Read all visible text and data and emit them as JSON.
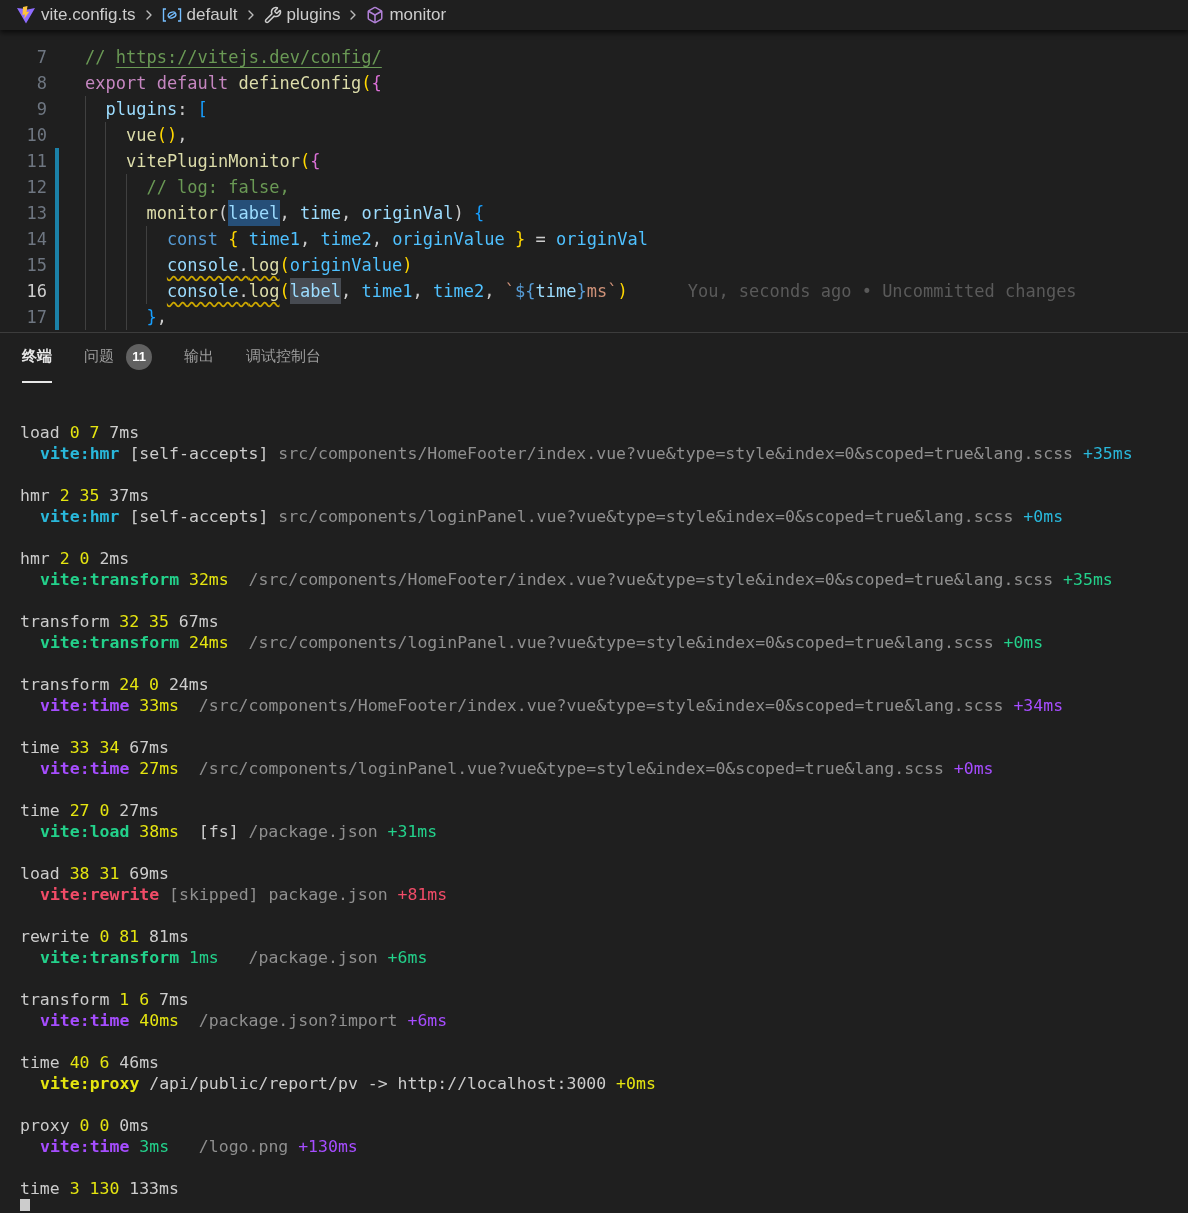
{
  "breadcrumb": [
    {
      "kind": "vite",
      "label": "vite.config.ts"
    },
    {
      "kind": "module",
      "label": "default"
    },
    {
      "kind": "property",
      "label": "plugins"
    },
    {
      "kind": "method",
      "label": "monitor"
    }
  ],
  "editor": {
    "lines": [
      {
        "number": "7",
        "current": false,
        "modified": false,
        "tokens": [
          {
            "kind": "comment",
            "text": "// "
          },
          {
            "kind": "link",
            "text": "https://vitejs.dev/config/"
          }
        ]
      },
      {
        "number": "8",
        "current": false,
        "modified": false,
        "tokens": [
          {
            "kind": "keyword",
            "text": "export default "
          },
          {
            "kind": "func",
            "text": "defineConfig"
          },
          {
            "kind": "bracket1",
            "text": "("
          },
          {
            "kind": "bracket2",
            "text": "{"
          }
        ],
        "children": [
          {
            "number": "9",
            "current": false,
            "modified": false,
            "tokens": [
              {
                "kind": "var",
                "text": "plugins"
              },
              {
                "kind": "plain",
                "text": ": "
              },
              {
                "kind": "bracket3",
                "text": "["
              }
            ],
            "children": [
              {
                "number": "10",
                "current": false,
                "modified": false,
                "tokens": [
                  {
                    "kind": "func",
                    "text": "vue"
                  },
                  {
                    "kind": "bracket1",
                    "text": "()"
                  },
                  {
                    "kind": "plain",
                    "text": ","
                  }
                ]
              },
              {
                "number": "11",
                "current": false,
                "modified": true,
                "tokens": [
                  {
                    "kind": "func",
                    "text": "vitePluginMonitor"
                  },
                  {
                    "kind": "bracket1",
                    "text": "("
                  },
                  {
                    "kind": "bracket2",
                    "text": "{"
                  }
                ],
                "children": [
                  {
                    "number": "12",
                    "current": false,
                    "modified": true,
                    "tokens": [
                      {
                        "kind": "comment",
                        "text": "// log: false,"
                      }
                    ]
                  },
                  {
                    "number": "13",
                    "current": false,
                    "modified": true,
                    "tokens": [
                      {
                        "kind": "func",
                        "text": "monitor"
                      },
                      {
                        "kind": "plain",
                        "text": "("
                      },
                      {
                        "kind": "var-selected",
                        "text": "label"
                      },
                      {
                        "kind": "plain",
                        "text": ", "
                      },
                      {
                        "kind": "var",
                        "text": "time"
                      },
                      {
                        "kind": "plain",
                        "text": ", "
                      },
                      {
                        "kind": "var",
                        "text": "originVal"
                      },
                      {
                        "kind": "plain",
                        "text": ") "
                      },
                      {
                        "kind": "bracket3",
                        "text": "{"
                      }
                    ],
                    "children": [
                      {
                        "number": "14",
                        "current": false,
                        "modified": true,
                        "tokens": [
                          {
                            "kind": "storage",
                            "text": "const "
                          },
                          {
                            "kind": "bracket1",
                            "text": "{ "
                          },
                          {
                            "kind": "const",
                            "text": "time1"
                          },
                          {
                            "kind": "plain",
                            "text": ", "
                          },
                          {
                            "kind": "const",
                            "text": "time2"
                          },
                          {
                            "kind": "plain",
                            "text": ", "
                          },
                          {
                            "kind": "const",
                            "text": "originValue "
                          },
                          {
                            "kind": "bracket1",
                            "text": "} "
                          },
                          {
                            "kind": "plain",
                            "text": "= "
                          },
                          {
                            "kind": "const",
                            "text": "originVal"
                          }
                        ]
                      },
                      {
                        "number": "15",
                        "current": false,
                        "modified": true,
                        "tokens": [
                          {
                            "kind": "var-warn",
                            "text": "console"
                          },
                          {
                            "kind": "plain-warn",
                            "text": "."
                          },
                          {
                            "kind": "func-warn",
                            "text": "log"
                          },
                          {
                            "kind": "bracket1",
                            "text": "("
                          },
                          {
                            "kind": "const",
                            "text": "originValue"
                          },
                          {
                            "kind": "bracket1",
                            "text": ")"
                          }
                        ]
                      },
                      {
                        "number": "16",
                        "current": true,
                        "modified": true,
                        "blame": "You, seconds ago • Uncommitted changes",
                        "tokens": [
                          {
                            "kind": "var-warn",
                            "text": "console"
                          },
                          {
                            "kind": "plain-warn",
                            "text": "."
                          },
                          {
                            "kind": "func-warn",
                            "text": "log"
                          },
                          {
                            "kind": "bracket1",
                            "text": "("
                          },
                          {
                            "kind": "var-match",
                            "text": "label"
                          },
                          {
                            "kind": "plain",
                            "text": ", "
                          },
                          {
                            "kind": "const",
                            "text": "time1"
                          },
                          {
                            "kind": "plain",
                            "text": ", "
                          },
                          {
                            "kind": "const",
                            "text": "time2"
                          },
                          {
                            "kind": "plain",
                            "text": ", "
                          },
                          {
                            "kind": "string",
                            "text": "`"
                          },
                          {
                            "kind": "storage",
                            "text": "${"
                          },
                          {
                            "kind": "var",
                            "text": "time"
                          },
                          {
                            "kind": "storage",
                            "text": "}"
                          },
                          {
                            "kind": "string",
                            "text": "ms`"
                          },
                          {
                            "kind": "bracket1",
                            "text": ")"
                          }
                        ]
                      }
                    ]
                  },
                  {
                    "number": "17",
                    "current": false,
                    "modified": true,
                    "tokens": [
                      {
                        "kind": "bracket3",
                        "text": "}"
                      },
                      {
                        "kind": "plain",
                        "text": ","
                      }
                    ]
                  }
                ]
              }
            ]
          }
        ]
      }
    ]
  },
  "panel": {
    "tabs": [
      {
        "label": "终端",
        "selected": true
      },
      {
        "label": "问题",
        "selected": false,
        "badge": "11"
      },
      {
        "label": "输出",
        "selected": false
      },
      {
        "label": "调试控制台",
        "selected": false
      }
    ]
  },
  "terminal": {
    "entries": [
      {
        "head": [
          {
            "kind": "word",
            "text": "load"
          },
          {
            "kind": "num",
            "text": "0 7"
          },
          {
            "kind": "word",
            "text": "7ms"
          }
        ],
        "detail": [
          {
            "kind": "cyan-tag",
            "text": "vite:hmr"
          },
          {
            "kind": "word",
            "text": "[self-accepts]"
          },
          {
            "kind": "dim",
            "text": "src/components/HomeFooter/index.vue?vue&type=style&index=0&scoped=true&lang.scss"
          },
          {
            "kind": "cyan",
            "text": "+35ms"
          }
        ]
      },
      {
        "head": [
          {
            "kind": "word",
            "text": "hmr"
          },
          {
            "kind": "num",
            "text": "2 35"
          },
          {
            "kind": "word",
            "text": "37ms"
          }
        ],
        "detail": [
          {
            "kind": "cyan-tag",
            "text": "vite:hmr"
          },
          {
            "kind": "word",
            "text": "[self-accepts]"
          },
          {
            "kind": "dim",
            "text": "src/components/loginPanel.vue?vue&type=style&index=0&scoped=true&lang.scss"
          },
          {
            "kind": "cyan",
            "text": "+0ms"
          }
        ]
      },
      {
        "head": [
          {
            "kind": "word",
            "text": "hmr"
          },
          {
            "kind": "num",
            "text": "2 0"
          },
          {
            "kind": "word",
            "text": "2ms"
          }
        ],
        "detail": [
          {
            "kind": "green-tag",
            "text": "vite:transform"
          },
          {
            "kind": "num",
            "text": "32ms"
          },
          {
            "kind": "dim",
            "text": " /src/components/HomeFooter/index.vue?vue&type=style&index=0&scoped=true&lang.scss"
          },
          {
            "kind": "green",
            "text": "+35ms"
          }
        ]
      },
      {
        "head": [
          {
            "kind": "word",
            "text": "transform"
          },
          {
            "kind": "num",
            "text": "32 35"
          },
          {
            "kind": "word",
            "text": "67ms"
          }
        ],
        "detail": [
          {
            "kind": "green-tag",
            "text": "vite:transform"
          },
          {
            "kind": "num",
            "text": "24ms"
          },
          {
            "kind": "dim",
            "text": " /src/components/loginPanel.vue?vue&type=style&index=0&scoped=true&lang.scss"
          },
          {
            "kind": "green",
            "text": "+0ms"
          }
        ]
      },
      {
        "head": [
          {
            "kind": "word",
            "text": "transform"
          },
          {
            "kind": "num",
            "text": "24 0"
          },
          {
            "kind": "word",
            "text": "24ms"
          }
        ],
        "detail": [
          {
            "kind": "purple-tag",
            "text": "vite:time"
          },
          {
            "kind": "num",
            "text": "33ms"
          },
          {
            "kind": "dim",
            "text": " /src/components/HomeFooter/index.vue?vue&type=style&index=0&scoped=true&lang.scss"
          },
          {
            "kind": "purple",
            "text": "+34ms"
          }
        ]
      },
      {
        "head": [
          {
            "kind": "word",
            "text": "time"
          },
          {
            "kind": "num",
            "text": "33 34"
          },
          {
            "kind": "word",
            "text": "67ms"
          }
        ],
        "detail": [
          {
            "kind": "purple-tag",
            "text": "vite:time"
          },
          {
            "kind": "num",
            "text": "27ms"
          },
          {
            "kind": "dim",
            "text": " /src/components/loginPanel.vue?vue&type=style&index=0&scoped=true&lang.scss"
          },
          {
            "kind": "purple",
            "text": "+0ms"
          }
        ]
      },
      {
        "head": [
          {
            "kind": "word",
            "text": "time"
          },
          {
            "kind": "num",
            "text": "27 0"
          },
          {
            "kind": "word",
            "text": "27ms"
          }
        ],
        "detail": [
          {
            "kind": "green-tag",
            "text": "vite:load"
          },
          {
            "kind": "num",
            "text": "38ms"
          },
          {
            "kind": "word",
            "text": " [fs]"
          },
          {
            "kind": "dim",
            "text": "/package.json"
          },
          {
            "kind": "green",
            "text": "+31ms"
          }
        ]
      },
      {
        "head": [
          {
            "kind": "word",
            "text": "load"
          },
          {
            "kind": "num",
            "text": "38 31"
          },
          {
            "kind": "word",
            "text": "69ms"
          }
        ],
        "detail": [
          {
            "kind": "red-tag",
            "text": "vite:rewrite"
          },
          {
            "kind": "dim",
            "text": "[skipped] package.json"
          },
          {
            "kind": "red",
            "text": "+81ms"
          }
        ]
      },
      {
        "head": [
          {
            "kind": "word",
            "text": "rewrite"
          },
          {
            "kind": "num",
            "text": "0 81"
          },
          {
            "kind": "word",
            "text": "81ms"
          }
        ],
        "detail": [
          {
            "kind": "green-tag",
            "text": "vite:transform"
          },
          {
            "kind": "green",
            "text": "1ms"
          },
          {
            "kind": "dim",
            "text": "  /package.json"
          },
          {
            "kind": "green",
            "text": "+6ms"
          }
        ]
      },
      {
        "head": [
          {
            "kind": "word",
            "text": "transform"
          },
          {
            "kind": "num",
            "text": "1 6"
          },
          {
            "kind": "word",
            "text": "7ms"
          }
        ],
        "detail": [
          {
            "kind": "purple-tag",
            "text": "vite:time"
          },
          {
            "kind": "num",
            "text": "40ms"
          },
          {
            "kind": "dim",
            "text": " /package.json?import"
          },
          {
            "kind": "purple",
            "text": "+6ms"
          }
        ]
      },
      {
        "head": [
          {
            "kind": "word",
            "text": "time"
          },
          {
            "kind": "num",
            "text": "40 6"
          },
          {
            "kind": "word",
            "text": "46ms"
          }
        ],
        "detail": [
          {
            "kind": "yellow-tag",
            "text": "vite:proxy"
          },
          {
            "kind": "word",
            "text": "/api/public/report/pv -> http://localhost:3000"
          },
          {
            "kind": "num",
            "text": "+0ms"
          }
        ]
      },
      {
        "head": [
          {
            "kind": "word",
            "text": "proxy"
          },
          {
            "kind": "num",
            "text": "0 0"
          },
          {
            "kind": "word",
            "text": "0ms"
          }
        ],
        "detail": [
          {
            "kind": "purple-tag",
            "text": "vite:time"
          },
          {
            "kind": "green",
            "text": "3ms"
          },
          {
            "kind": "dim",
            "text": "  /logo.png"
          },
          {
            "kind": "purple",
            "text": "+130ms"
          }
        ]
      }
    ],
    "last": [
      {
        "kind": "word",
        "text": "time"
      },
      {
        "kind": "num",
        "text": "3 130"
      },
      {
        "kind": "word",
        "text": "133ms"
      }
    ]
  }
}
